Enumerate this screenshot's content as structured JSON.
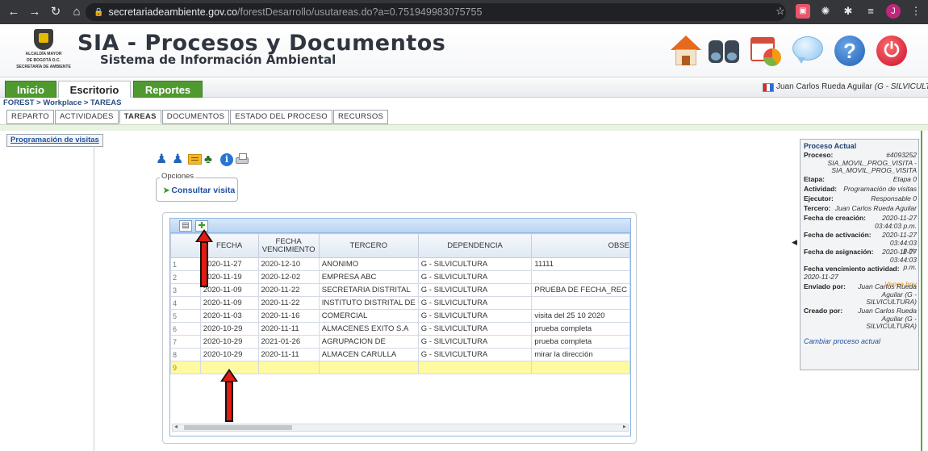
{
  "browser": {
    "url_host": "secretariadeambiente.gov.co",
    "url_path": "/forestDesarrollo/usutareas.do?a=0.751949983075755",
    "profile_initial": "J"
  },
  "header": {
    "logo_lines": [
      "ALCALDÍA MAYOR",
      "DE BOGOTÁ D.C.",
      "SECRETARÍA DE AMBIENTE"
    ],
    "title": "SIA - Procesos y Documentos",
    "subtitle": "Sistema de Información Ambiental"
  },
  "menu": {
    "tabs": [
      {
        "label": "Inicio"
      },
      {
        "label": "Escritorio"
      },
      {
        "label": "Reportes"
      }
    ],
    "user_name": "Juan Carlos Rueda Aguilar",
    "user_role": "(G - SILVICULTURA)"
  },
  "breadcrumb": "FOREST > Workplace > TAREAS",
  "subtabs": [
    "REPARTO",
    "ACTIVIDADES",
    "TAREAS",
    "DOCUMENTOS",
    "ESTADO DEL PROCESO",
    "RECURSOS"
  ],
  "prog_tab": "Programación de visitas",
  "opciones": {
    "legend": "Opciones",
    "button": "Consultar visita"
  },
  "grid": {
    "columns": [
      "",
      "FECHA",
      "FECHA VENCIMIENTO",
      "TERCERO",
      "DEPENDENCIA",
      "OBSE"
    ],
    "rows": [
      [
        "1",
        "2020-11-27",
        "2020-12-10",
        "ANONIMO",
        "G - SILVICULTURA",
        "11111"
      ],
      [
        "2",
        "2020-11-19",
        "2020-12-02",
        "EMPRESA ABC",
        "G - SILVICULTURA",
        ""
      ],
      [
        "3",
        "2020-11-09",
        "2020-11-22",
        "SECRETARIA DISTRITAL",
        "G - SILVICULTURA",
        "PRUEBA DE FECHA_REC"
      ],
      [
        "4",
        "2020-11-09",
        "2020-11-22",
        "INSTITUTO DISTRITAL DE",
        "G - SILVICULTURA",
        ""
      ],
      [
        "5",
        "2020-11-03",
        "2020-11-16",
        "COMERCIAL",
        "G - SILVICULTURA",
        "visita del 25 10 2020"
      ],
      [
        "6",
        "2020-10-29",
        "2020-11-11",
        "ALMACENES EXITO S.A",
        "G - SILVICULTURA",
        "prueba completa"
      ],
      [
        "7",
        "2020-10-29",
        "2021-01-26",
        "AGRUPACION DE",
        "G - SILVICULTURA",
        "prueba completa"
      ],
      [
        "8",
        "2020-10-29",
        "2020-11-11",
        "ALMACEN CARULLA",
        "G - SILVICULTURA",
        "mirar la dirección"
      ],
      [
        "9",
        "",
        "",
        "",
        "",
        ""
      ]
    ]
  },
  "proceso": {
    "title": "Proceso Actual",
    "proceso_label": "Proceso:",
    "proceso_num": "#4093252",
    "proceso_name": "SIA_MOVIL_PROG_VISITA - SIA_MOVIL_PROG_VISITA",
    "etapa_label": "Etapa:",
    "etapa": "Etapa 0",
    "actividad_label": "Actividad:",
    "actividad": "Programación de visitas",
    "ejecutor_label": "Ejecutor:",
    "ejecutor": "Responsable 0",
    "tercero_label": "Tercero:",
    "tercero": "Juan Carlos Rueda Aguilar",
    "creacion_label": "Fecha de creación:",
    "creacion": "2020-11-27 03:44:03 p.m.",
    "activacion_label": "Fecha de activación:",
    "activacion": "2020-11-27 03:44:03 p.m.",
    "asignacion_label": "Fecha de asignación:",
    "asignacion": "2020-11-27 03:44:03 p.m.",
    "vencimiento_label": "Fecha vencimiento actividad:",
    "vencimiento": "2020-11-27",
    "vence_hoy": "Vence hoy",
    "enviado_label": "Enviado por:",
    "enviado": "Juan Carlos Rueda Aguilar (G - SILVICULTURA)",
    "creado_label": "Creado por:",
    "creado": "Juan Carlos Rueda Aguilar (G - SILVICULTURA)",
    "link": "Cambiar proceso actual"
  },
  "colors": {
    "menu_green": "#4f9a2f",
    "arrow_red": "#e31b12",
    "new_row": "#fff9a0",
    "link_blue": "#1f4fa0"
  }
}
